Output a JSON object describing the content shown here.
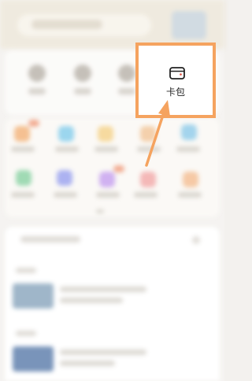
{
  "callout": {
    "label": "卡包",
    "icon": "wallet-icon",
    "highlight_color": "#f5a35f"
  },
  "background": {
    "blurred": true,
    "icon_colors": [
      "#f3b37a",
      "#86cdeb",
      "#f5d28a",
      "#f2c69a",
      "#8fcbe9",
      "#8bd2a4",
      "#9aa2ee",
      "#c6a0ee",
      "#f2a9a8",
      "#f4be92"
    ]
  }
}
